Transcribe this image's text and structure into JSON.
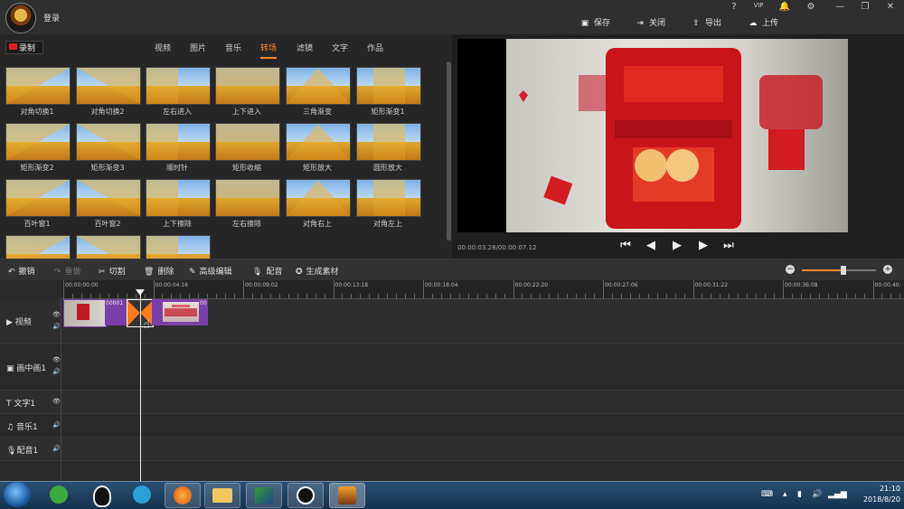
{
  "header": {
    "login": "登录",
    "window_buttons": [
      "?",
      "VIP",
      "🔔",
      "⚙",
      "—",
      "❐",
      "✕"
    ],
    "actions": [
      {
        "label": "保存",
        "icon": "save-icon"
      },
      {
        "label": "关闭",
        "icon": "exit-icon"
      },
      {
        "label": "导出",
        "icon": "export-icon"
      },
      {
        "label": "上传",
        "icon": "upload-icon"
      }
    ]
  },
  "left_panel": {
    "record_label": "录制",
    "tabs": [
      "视频",
      "图片",
      "音乐",
      "转场",
      "滤镜",
      "文字",
      "作品"
    ],
    "active_tab": "转场",
    "transitions": [
      "对角切换1",
      "对角切换2",
      "左右进入",
      "上下进入",
      "三角渐变",
      "矩形渐变1",
      "矩形渐变2",
      "矩形渐变3",
      "顺时针",
      "矩形收缩",
      "矩形放大",
      "圆形放大",
      "百叶窗1",
      "百叶窗2",
      "上下擦除",
      "左右擦除",
      "对角右上",
      "对角左上",
      "",
      "",
      ""
    ]
  },
  "preview": {
    "timecode": "00:00:03.28/00:00:07.12"
  },
  "toolbar": {
    "undo": "撤销",
    "redo": "重做",
    "cut": "切割",
    "delete": "删除",
    "advanced_edit": "高级编辑",
    "dub": "配音",
    "generate": "生成素材",
    "zoom_level": 0.55
  },
  "timeline": {
    "ruler": [
      "00:00:00:00",
      "00:00:04:16",
      "00:00:09:02",
      "00:00:13:18",
      "00:00:18:04",
      "00:00:22:20",
      "00:00:27:06",
      "00:00:31:22",
      "00:00:36:08",
      "00:00:40:"
    ],
    "tracks": [
      {
        "label": "视频",
        "icon": "video-icon"
      },
      {
        "label": "画中画1",
        "icon": "pip-icon"
      },
      {
        "label": "文字1",
        "icon": "text-icon"
      },
      {
        "label": "音乐1",
        "icon": "music-icon"
      },
      {
        "label": "配音1",
        "icon": "mic-icon"
      }
    ],
    "clip_label_1": "00001",
    "clip_label_2": "00"
  },
  "taskbar": {
    "time": "21:10",
    "date": "2018/8/20"
  },
  "colors": {
    "accent": "#ff8a2a",
    "record_red": "#e02020",
    "clip_purple": "#7a3fa8"
  }
}
